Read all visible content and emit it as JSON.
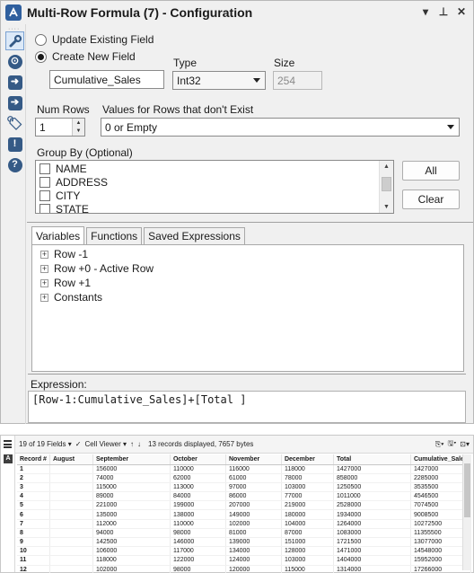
{
  "window": {
    "title": "Multi-Row Formula (7) - Configuration",
    "controls": [
      "▾",
      "⊥",
      "✕"
    ]
  },
  "options": {
    "update_existing_label": "Update Existing Field",
    "create_new_label": "Create New  Field",
    "selected": "create_new"
  },
  "new_field": {
    "name": "Cumulative_Sales",
    "type_label": "Type",
    "type_value": "Int32",
    "size_label": "Size",
    "size_value": "254"
  },
  "num_rows": {
    "label": "Num Rows",
    "value": "1"
  },
  "nonexistent": {
    "label": "Values for Rows that don't Exist",
    "value": "0 or Empty"
  },
  "group_by": {
    "label": "Group By (Optional)",
    "fields": [
      "NAME",
      "ADDRESS",
      "CITY",
      "STATE"
    ],
    "all_label": "All",
    "clear_label": "Clear"
  },
  "tabs": [
    "Variables",
    "Functions",
    "Saved Expressions"
  ],
  "variables": [
    "Row -1",
    "Row +0 - Active Row",
    "Row +1",
    "Constants"
  ],
  "expression": {
    "label": "Expression:",
    "value": "[Row-1:Cumulative_Sales]+[Total ]"
  },
  "results": {
    "fields_label": "19 of 19 Fields",
    "viewer_label": "Cell Viewer",
    "records_info": "13 records displayed, 7657 bytes",
    "columns": [
      "Record #",
      "August",
      "September",
      "October",
      "November",
      "December",
      "Total",
      "Cumulative_Sales"
    ],
    "rows": [
      [
        "1",
        "",
        "156000",
        "110000",
        "116000",
        "118000",
        "1427000",
        "1427000"
      ],
      [
        "2",
        "",
        "74000",
        "62000",
        "61000",
        "78000",
        "858000",
        "2285000"
      ],
      [
        "3",
        "",
        "115000",
        "113000",
        "97000",
        "103000",
        "1250500",
        "3535500"
      ],
      [
        "4",
        "",
        "89000",
        "84000",
        "86000",
        "77000",
        "1011000",
        "4546500"
      ],
      [
        "5",
        "",
        "221000",
        "199000",
        "207000",
        "219000",
        "2528000",
        "7074500"
      ],
      [
        "6",
        "",
        "135000",
        "138000",
        "149000",
        "180000",
        "1934000",
        "9008500"
      ],
      [
        "7",
        "",
        "112000",
        "110000",
        "102000",
        "104000",
        "1264000",
        "10272500"
      ],
      [
        "8",
        "",
        "94000",
        "98000",
        "81000",
        "87000",
        "1083000",
        "11355500"
      ],
      [
        "9",
        "",
        "142500",
        "146000",
        "139000",
        "151000",
        "1721500",
        "13077000"
      ],
      [
        "10",
        "",
        "106000",
        "117000",
        "134000",
        "128000",
        "1471000",
        "14548000"
      ],
      [
        "11",
        "",
        "118000",
        "122000",
        "124000",
        "103000",
        "1404000",
        "15952000"
      ],
      [
        "12",
        "",
        "102000",
        "98000",
        "120000",
        "115000",
        "1314000",
        "17266000"
      ]
    ]
  },
  "colors": {
    "panel_bg": "#f0f0f0",
    "side_icon": "#355a86",
    "active_tool": "#dce9f8"
  },
  "icons": [
    "alteryx-logo",
    "wrench-icon",
    "steering-icon",
    "input-arrow-icon",
    "output-arrow-icon",
    "tag-icon",
    "warning-bubble-icon",
    "help-icon"
  ]
}
